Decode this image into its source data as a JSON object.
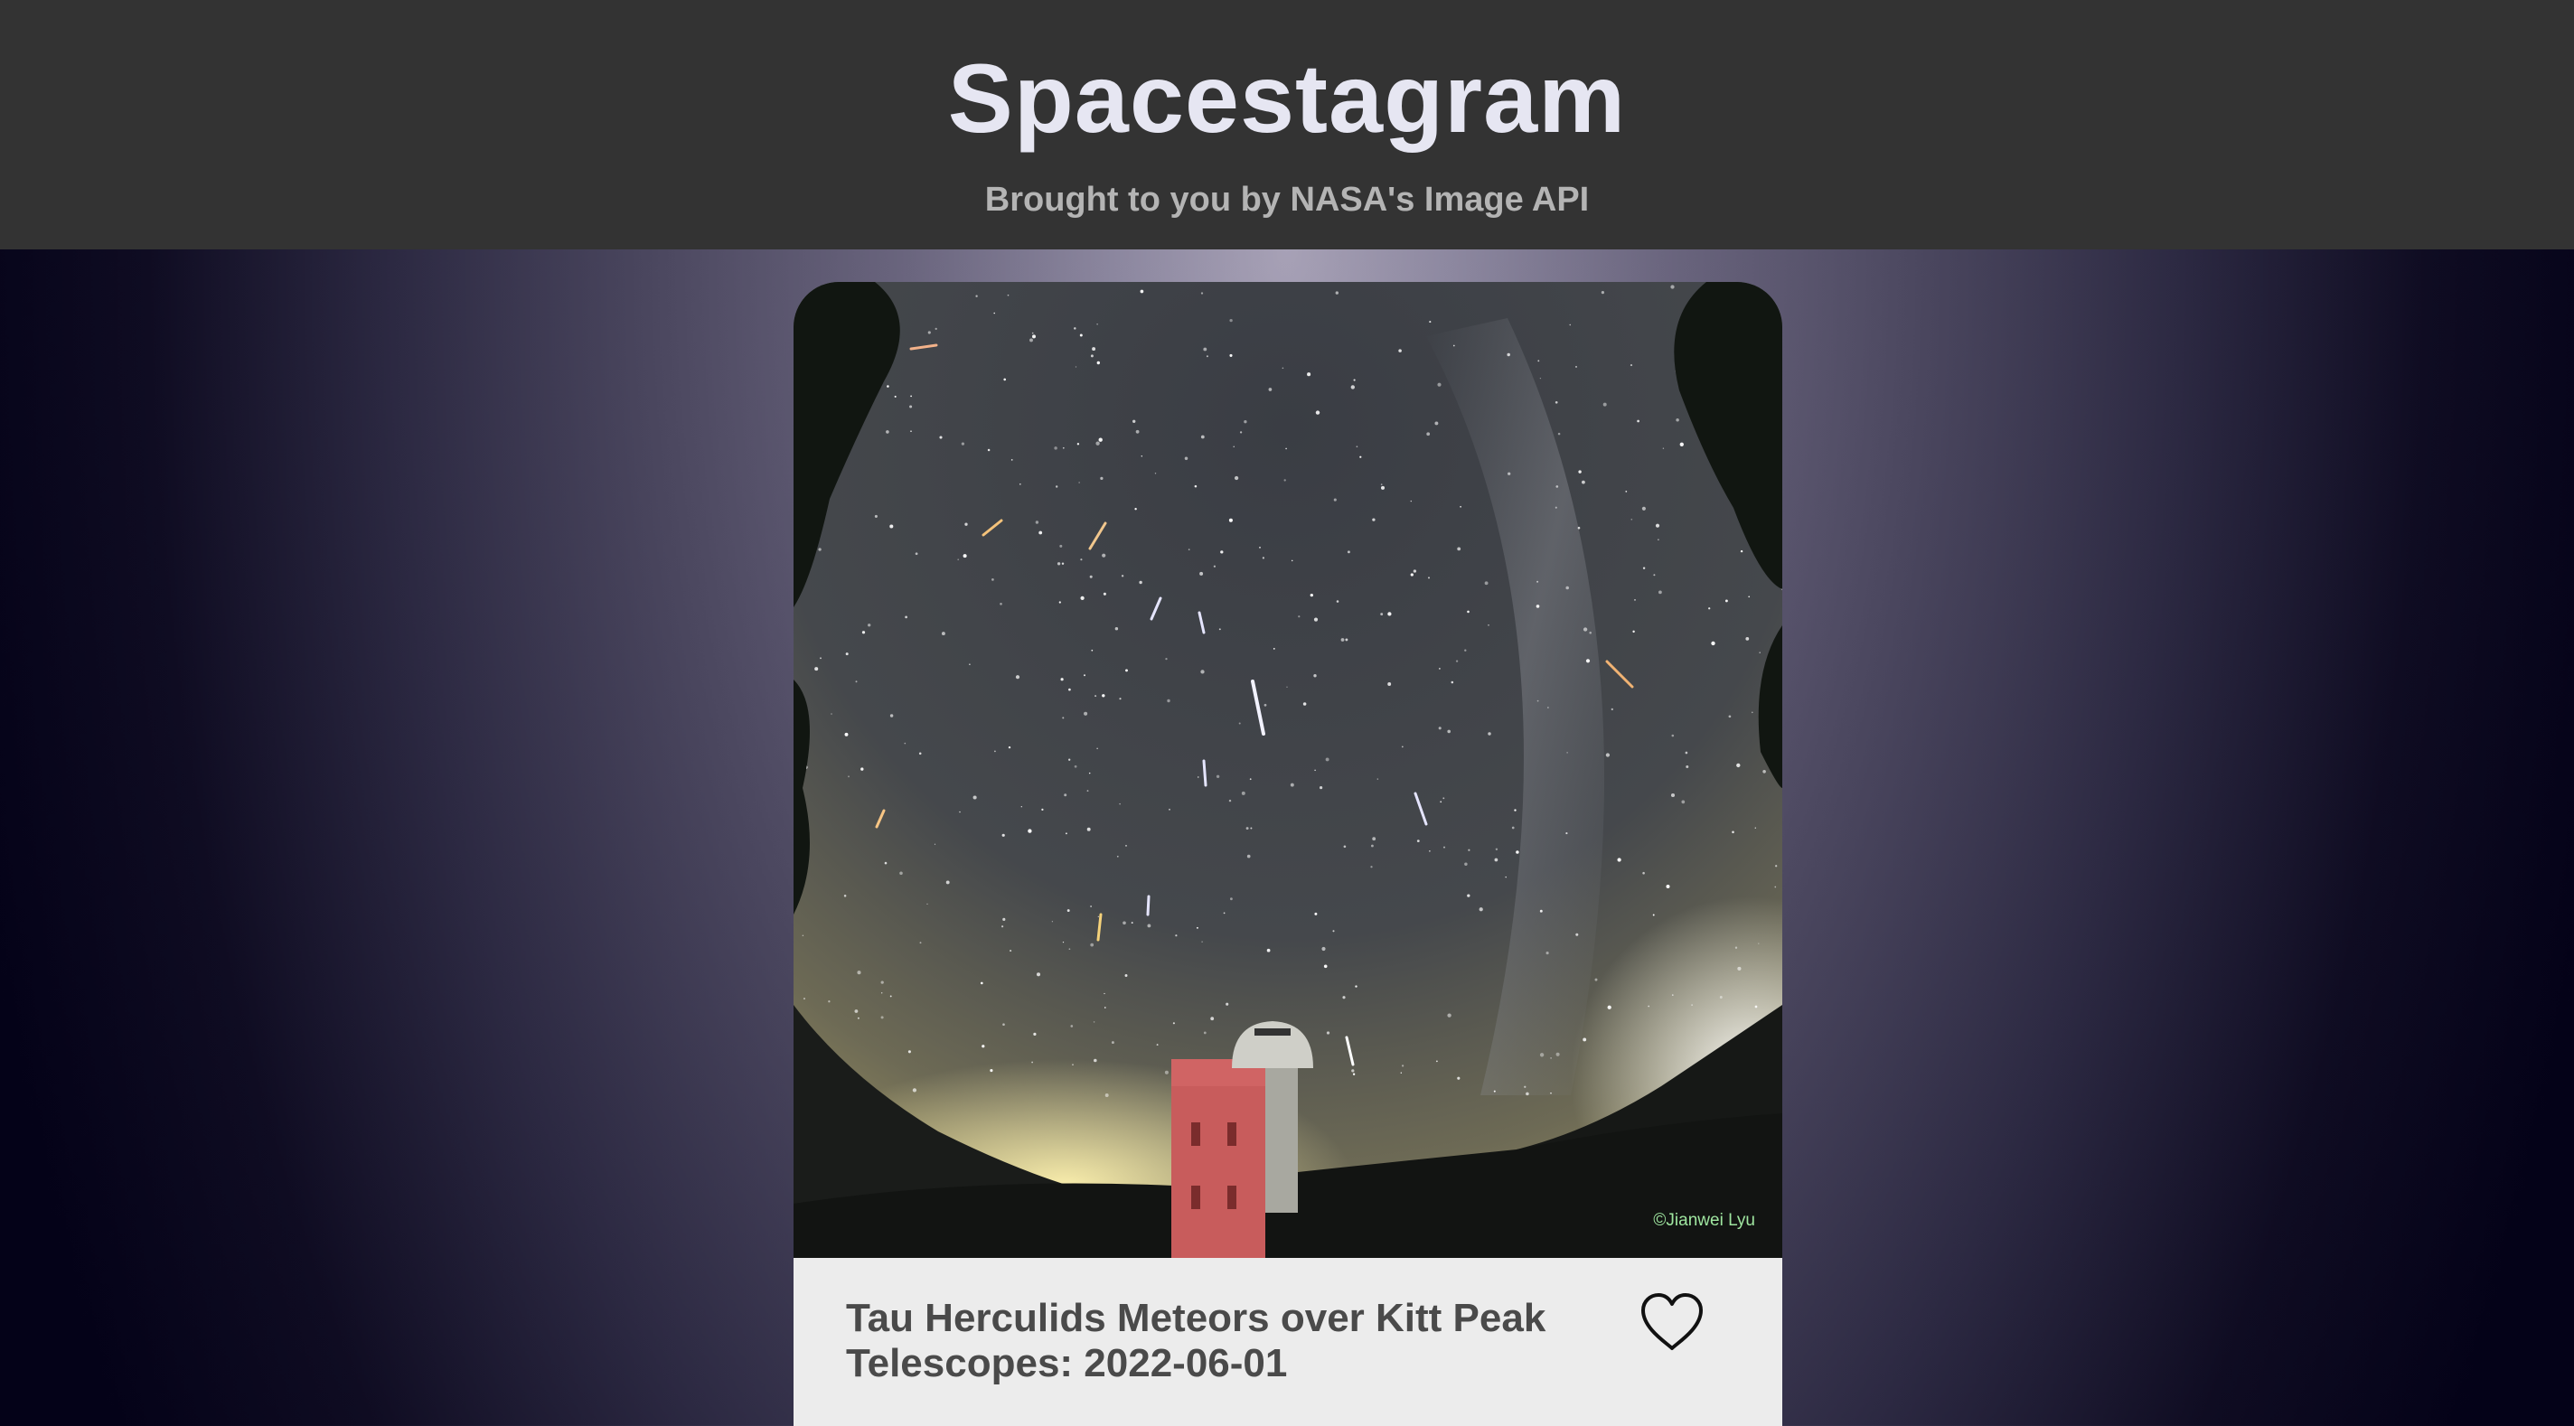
{
  "header": {
    "title": "Spacestagram",
    "subtitle": "Brought to you by NASA's Image API"
  },
  "post": {
    "title": "Tau Herculids Meteors over Kitt Peak Telescopes: 2022-06-01",
    "image_watermark": "©Jianwei Lyu",
    "liked": false,
    "like_icon": "heart-outline-icon"
  },
  "colors": {
    "header_bg": "#333333",
    "title_text": "#e6e6f2",
    "subtitle_text": "#b4b4b4",
    "card_bg": "#ececec",
    "card_title_text": "#4a4a4a"
  }
}
